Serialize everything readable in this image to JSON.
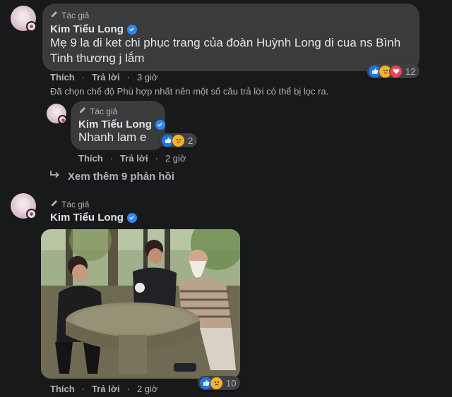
{
  "comments": [
    {
      "author_tag": "Tác giả",
      "author": "Kim Tiểu Long",
      "text": "Mẹ 9 la di ket chi phục trang của đoàn Huỳnh Long di cua ns Bình Tinh thương j lắm",
      "like_label": "Thích",
      "reply_label": "Trả lời",
      "time": "3 giờ",
      "reaction_count": "12"
    }
  ],
  "filter_note": "Đã chọn chế độ Phù hợp nhất nên một số câu trả lời có thể bị lọc ra.",
  "reply": {
    "author_tag": "Tác giả",
    "author": "Kim Tiểu Long",
    "text": "Nhanh lam e",
    "like_label": "Thích",
    "reply_label": "Trả lời",
    "time": "2 giờ",
    "reaction_count": "2"
  },
  "view_more": "Xem thêm 9 phản hồi",
  "photo_comment": {
    "author_tag": "Tác giả",
    "author": "Kim Tiểu Long",
    "like_label": "Thích",
    "reply_label": "Trả lời",
    "time": "2 giờ",
    "reaction_count": "10"
  },
  "colors": {
    "background": "#18191a",
    "bubble": "#3a3b3c",
    "verified": "#2d88ff",
    "like": "#1877f2",
    "sad": "#f7b125",
    "love": "#f33e58"
  }
}
